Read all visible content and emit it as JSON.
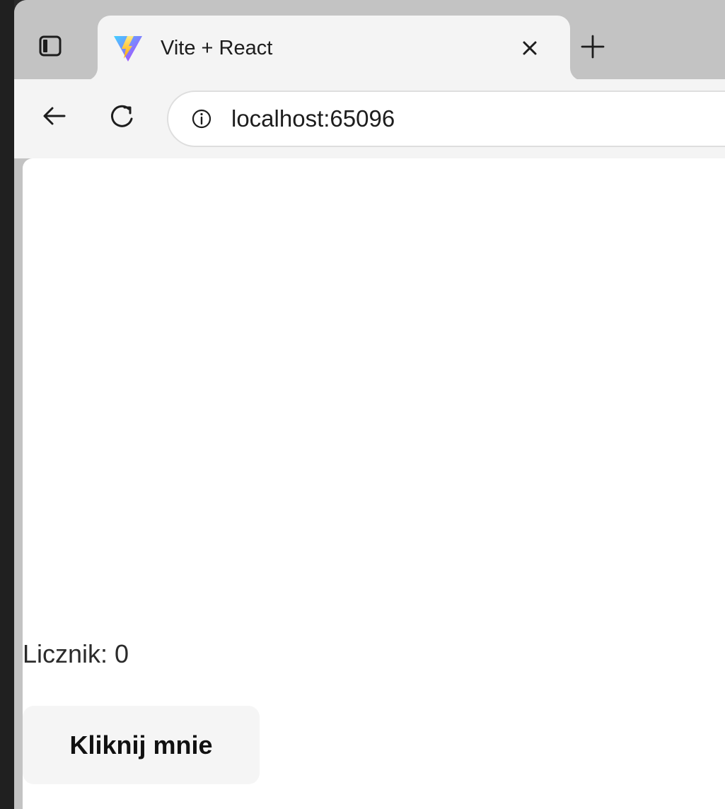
{
  "browser": {
    "tab": {
      "title": "Vite + React",
      "favicon": "vite-logo-icon",
      "close_icon": "close-icon"
    },
    "new_tab_icon": "plus-icon",
    "sidebar_toggle_icon": "tab-sidebar-icon",
    "navigation": {
      "back_icon": "back-arrow-icon",
      "reload_icon": "reload-icon"
    },
    "address_bar": {
      "info_icon": "site-info-icon",
      "url": "localhost:65096"
    },
    "colors": {
      "tab_strip": "#c3c3c3",
      "active_tab": "#f4f4f4",
      "page_background": "#ffffff",
      "text": "#1d1d1d"
    }
  },
  "page": {
    "counter_text": "Licznik: 0",
    "button_label": "Kliknij mnie"
  }
}
